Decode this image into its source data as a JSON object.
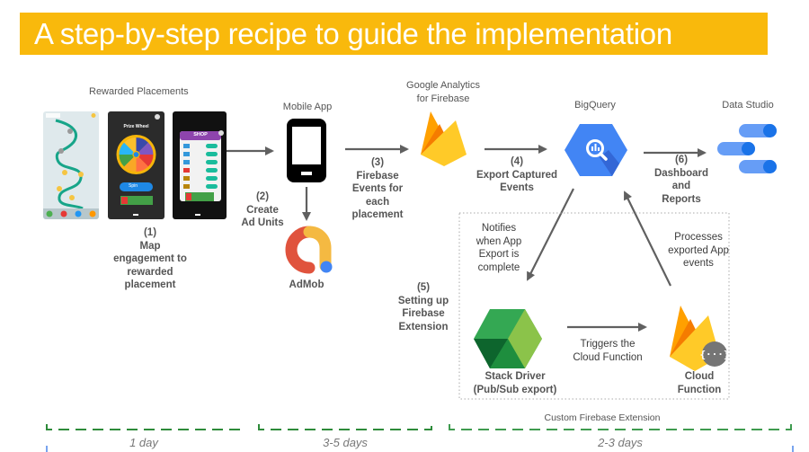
{
  "title": "A step-by-step recipe to guide the implementation",
  "colors": {
    "title_bg": "#f9b90c",
    "arrow": "#606060",
    "timeline_green": "#2e8b3a",
    "timeline_blue": "#4a86e8",
    "firebase_yellow": "#ffca28",
    "firebase_orange": "#f57c00",
    "bigquery_blue": "#4285f4",
    "admob_red": "#e0533d",
    "admob_yellow": "#f4b942",
    "stackdriver_green": "#34a853"
  },
  "nodes": {
    "rewarded_placements": {
      "label": "Rewarded Placements",
      "screens": [
        "Map screen",
        "Prize Wheel",
        "SHOP"
      ],
      "prize_wheel_title": "Prize Wheel",
      "spin_label": "Spin",
      "shop_title": "SHOP"
    },
    "mobile_app": {
      "label": "Mobile App"
    },
    "admob": {
      "label": "AdMob"
    },
    "google_analytics": {
      "label_line1": "Google Analytics",
      "label_line2": "for Firebase"
    },
    "bigquery": {
      "label": "BigQuery"
    },
    "data_studio": {
      "label": "Data Studio"
    },
    "stack_driver": {
      "label_line1": "Stack Driver",
      "label_line2": "(Pub/Sub export)"
    },
    "cloud_function": {
      "label_line1": "Cloud",
      "label_line2": "Function",
      "badge": "{···}"
    }
  },
  "steps": {
    "step1": {
      "num": "(1)",
      "lines": [
        "Map",
        "engagement to",
        "rewarded",
        "placement"
      ]
    },
    "step2": {
      "num": "(2)",
      "lines": [
        "Create",
        "Ad Units"
      ]
    },
    "step3": {
      "num": "(3)",
      "lines": [
        "Firebase",
        "Events for",
        "each",
        "placement"
      ]
    },
    "step4": {
      "num": "(4)",
      "lines": [
        "Export Captured",
        "Events"
      ]
    },
    "step5": {
      "num": "(5)",
      "lines": [
        "Setting up",
        "Firebase",
        "Extension"
      ]
    },
    "step6": {
      "num": "(6)",
      "lines": [
        "Dashboard",
        "and",
        "Reports"
      ]
    }
  },
  "annotations": {
    "notifies": [
      "Notifies",
      "when App",
      "Export is",
      "complete"
    ],
    "processes": [
      "Processes",
      "exported App",
      "events"
    ],
    "triggers": [
      "Triggers the",
      "Cloud Function"
    ]
  },
  "extension_box_label": "Custom  Firebase Extension",
  "timeline": [
    {
      "label": "1 day"
    },
    {
      "label": "3-5 days"
    },
    {
      "label": "2-3 days"
    }
  ]
}
